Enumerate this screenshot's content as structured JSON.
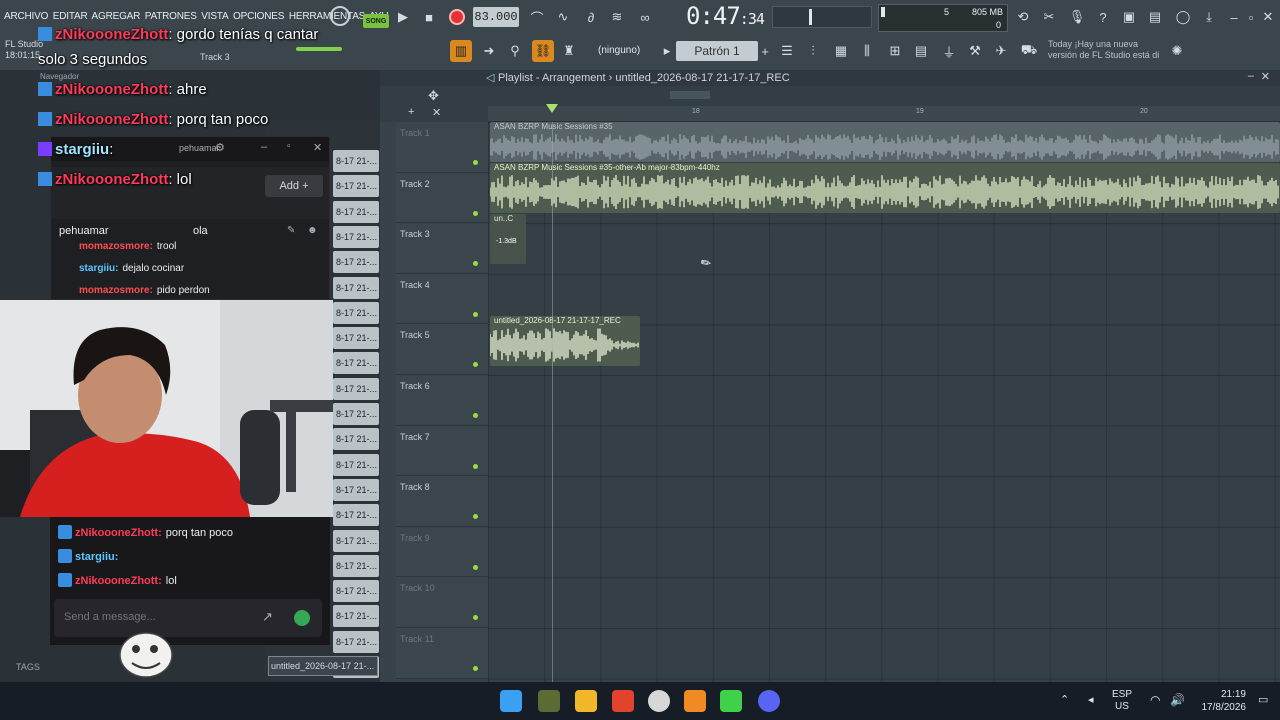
{
  "fl": {
    "menu": [
      "ARCHIVO",
      "EDITAR",
      "AGREGAR",
      "PATRONES",
      "VISTA",
      "OPCIONES",
      "HERRAMIENTAS",
      "AYU"
    ],
    "song_badge": "SONG",
    "tempo": "83.000",
    "clock_main": "0:47",
    "clock_sub": ":34",
    "cpu_mem": "805 MB",
    "cpu_num": "5",
    "cpu_zero": "0",
    "studio_label": "FL Studio",
    "studio_time": "18:01:15",
    "track_hint": "Track 3",
    "pattern_sel": "(ninguno)",
    "pattern_box": "Patrón 1",
    "news_title": "Today  ¡Hay una nueva",
    "news_body": "versión de FL Studio está di",
    "navegador": "Navegador",
    "tags": "TAGS"
  },
  "playlist": {
    "title": "Playlist - Arrangement › untitled_2026-08-17 21-17-17_REC",
    "bars": [
      "18",
      "19",
      "20"
    ],
    "tracks": [
      {
        "name": "Track 1",
        "dim": true
      },
      {
        "name": "Track 2",
        "dim": false
      },
      {
        "name": "Track 3",
        "dim": false
      },
      {
        "name": "Track 4",
        "dim": false
      },
      {
        "name": "Track 5",
        "dim": false
      },
      {
        "name": "Track 6",
        "dim": false
      },
      {
        "name": "Track 7",
        "dim": false
      },
      {
        "name": "Track 8",
        "dim": false
      },
      {
        "name": "Track 9",
        "dim": true
      },
      {
        "name": "Track 10",
        "dim": true
      },
      {
        "name": "Track 11",
        "dim": true
      }
    ],
    "clip1": "ASAN  BZRP Music Sessions #35",
    "clip2": "ASAN BZRP Music Sessions #35-other-Ab major-83bpm-440hz",
    "clip3": "un..C",
    "clip3_db": "-1.3dB",
    "clip5": "untitled_2026-08-17 21-17-17_REC",
    "pattern_list_label": "untitled_2026-08-17 21-...",
    "pattern_list_short": "8-17 21-..."
  },
  "overlay": {
    "lines": [
      {
        "user": "zNikoooneZhott",
        "msg": ": gordo tenías q cantar"
      },
      {
        "user": "",
        "msg": "solo 3 segundos"
      },
      {
        "user": "zNikoooneZhott",
        "msg": ": ahre"
      },
      {
        "user": "zNikoooneZhott",
        "msg": ": porq tan poco"
      },
      {
        "user": "stargiiu",
        "msg": ":"
      },
      {
        "user": "zNikoooneZhott",
        "msg": ": lol"
      }
    ]
  },
  "popup": {
    "user_hint": "pehuamar",
    "add_label": "Add",
    "user": "pehuamar",
    "msg": "ola",
    "lines": [
      {
        "user": "momazosmore:",
        "msg": "trool",
        "color": "#ff4d4d"
      },
      {
        "user": "stargiiu:",
        "msg": "dejalo cocinar",
        "color": "#5cc8ff"
      },
      {
        "user": "momazosmore:",
        "msg": "pido perdon",
        "color": "#ff4d4d"
      }
    ]
  },
  "chat": {
    "lines": [
      {
        "user": "zNikoooneZhott:",
        "msg": "porq tan poco",
        "color": "#ff3a5a"
      },
      {
        "user": "stargiiu:",
        "msg": "",
        "color": "#5cc8ff"
      },
      {
        "user": "zNikoooneZhott:",
        "msg": "lol",
        "color": "#ff3a5a"
      }
    ],
    "placeholder": "Send a message..."
  },
  "taskbar": {
    "lang1": "ESP",
    "lang2": "US",
    "time": "21:19",
    "date": "17/8/2026"
  }
}
